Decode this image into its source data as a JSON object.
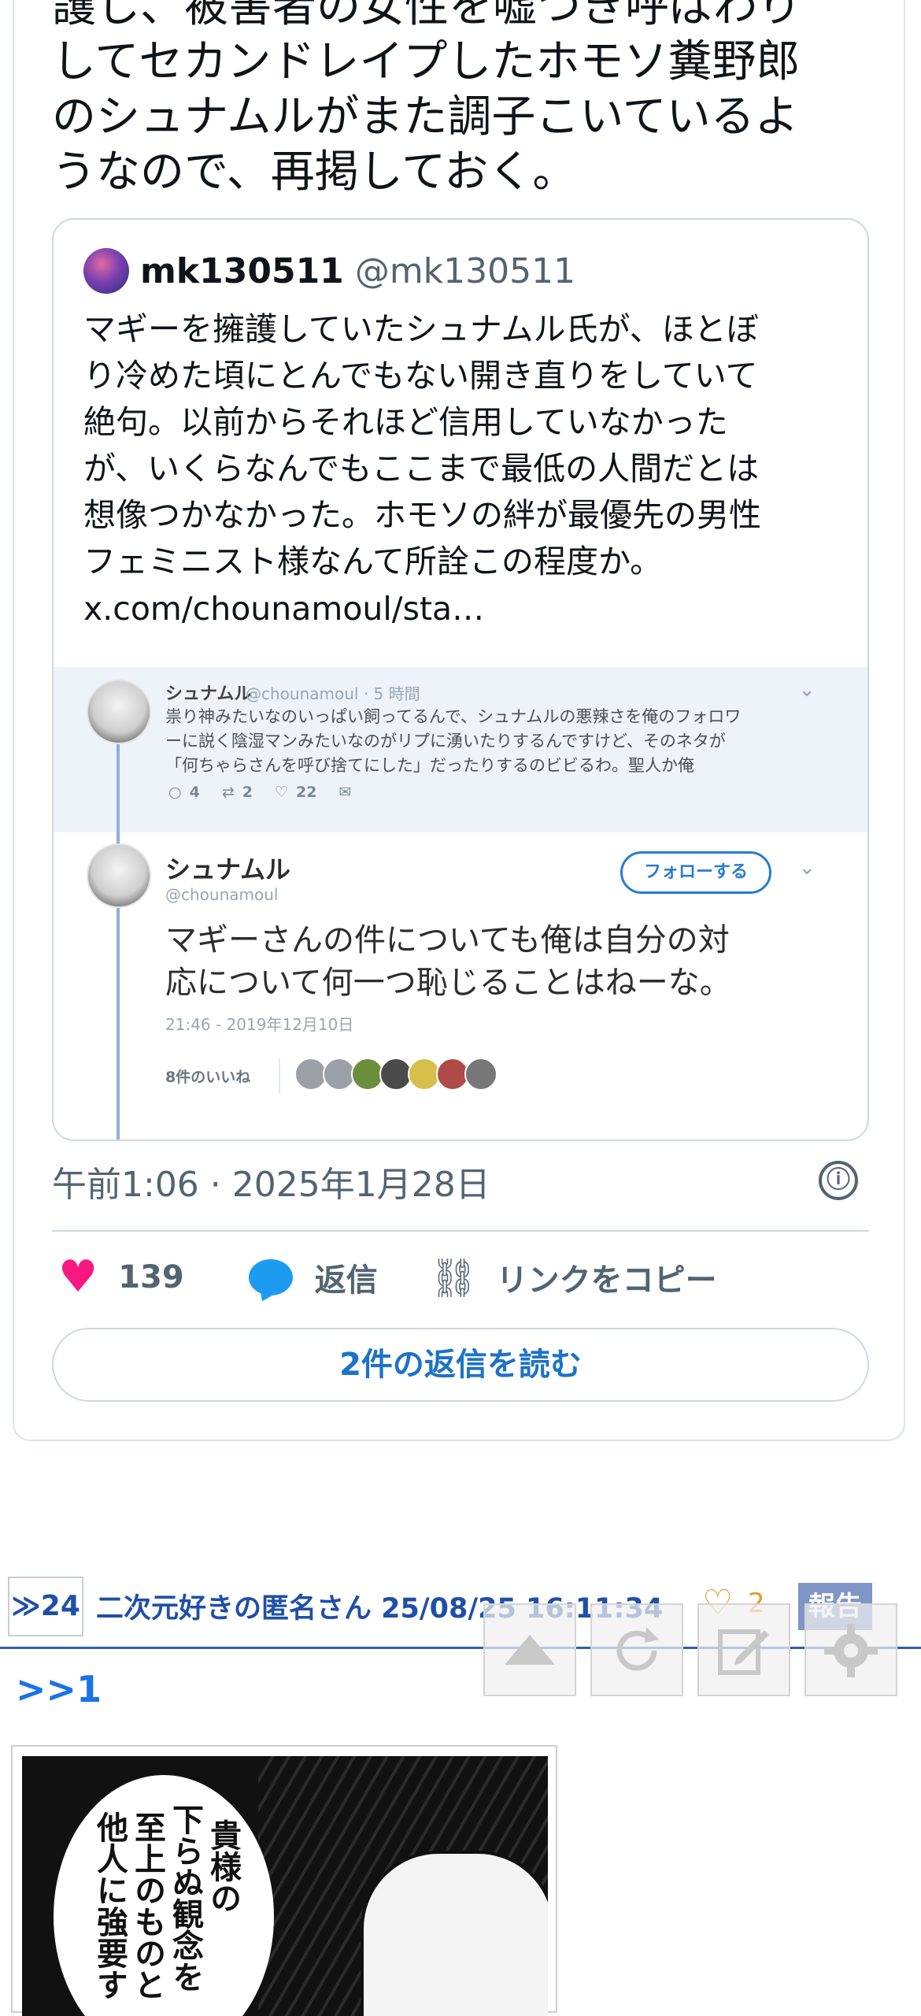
{
  "tweet": {
    "text": "護し、被害者の女性を嘘つき呼ばわり\nしてセカンドレイプしたホモソ糞野郎\nのシュナムルがまた調子こいているよ\nうなので、再掲しておく。",
    "timestamp": "午前1:06 · 2025年1月28日",
    "like_count": "139",
    "reply_label": "返信",
    "copy_link_label": "リンクをコピー",
    "read_replies_label": "2件の返信を読む",
    "info_icon": "ⓘ"
  },
  "quote": {
    "display_name": "mk130511",
    "handle": "@mk130511",
    "text": "マギーを擁護していたシュナムル氏が、ほとぼ\nり冷めた頃にとんでもない開き直りをしていて\n絶句。以前からそれほど信用していなかった\nが、いくらなんでもここまで最低の人間だとは\n想像つかなかった。ホモソの絆が最優先の男性\nフェミニスト様なんて所詮この程度か。",
    "url": "x.com/chounamoul/sta…"
  },
  "screenshot": {
    "reply_name": "シュナムル",
    "reply_meta": "@chounamoul · 5 時間",
    "reply_text": "祟り神みたいなのいっぱい飼ってるんで、シュナムルの悪辣さを俺のフォロワ\nーに説く陰湿マンみたいなのがリプに湧いたりするんですけど、そのネタが\n「何ちゃらさんを呼び捨てにした」だったりするのビビるわ。聖人か俺",
    "reply_count": "4",
    "rt_count": "2",
    "like_count": "22",
    "main_name": "シュナムル",
    "main_handle": "@chounamoul",
    "follow_label": "フォローする",
    "main_text": "マギーさんの件についても俺は自分の対\n応について何一つ恥じることはねーな。",
    "date": "21:46 - 2019年12月10日",
    "likes_label": "8件のいいね"
  },
  "post": {
    "number": "≫24",
    "header": "二次元好きの匿名さん 25/08/25 16:11:34",
    "like_count": "2",
    "report_label": "報告",
    "anchor": ">>1",
    "manga_text_col1": "貴様の",
    "manga_text_col2": "下らぬ観念を",
    "manga_text_col3": "至上のものと",
    "manga_text_col4": "他人に強要す"
  },
  "float_buttons": [
    "scroll-top",
    "reload",
    "compose",
    "settings"
  ],
  "colors": {
    "like": "#f91880",
    "reply": "#1d9bf0",
    "link_blue": "#1d72c9",
    "header_blue": "#1f4fa8",
    "report_bg": "#7f95c7"
  }
}
